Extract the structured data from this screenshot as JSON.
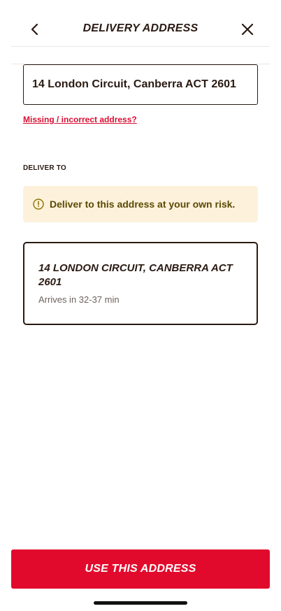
{
  "header": {
    "title": "DELIVERY ADDRESS",
    "back_icon": "chevron-left-icon",
    "close_icon": "close-icon"
  },
  "address_input": {
    "value": "14 London Circuit, Canberra ACT 2601",
    "placeholder": ""
  },
  "missing_link": "Missing / incorrect address?",
  "deliver_to_label": "DELIVER TO",
  "warning": {
    "icon": "alert-circle-icon",
    "text": "Deliver to this address at your own risk."
  },
  "address_card": {
    "title": "14 LONDON CIRCUIT, CANBERRA ACT 2601",
    "subtitle": "Arrives in 32-37 min"
  },
  "primary_button": "USE THIS ADDRESS",
  "colors": {
    "brand_red": "#e20a2c",
    "link_red": "#d90f32",
    "text_dark": "#2a1a12",
    "warning_bg": "#fdf1dc",
    "warning_text": "#5a4a00"
  }
}
